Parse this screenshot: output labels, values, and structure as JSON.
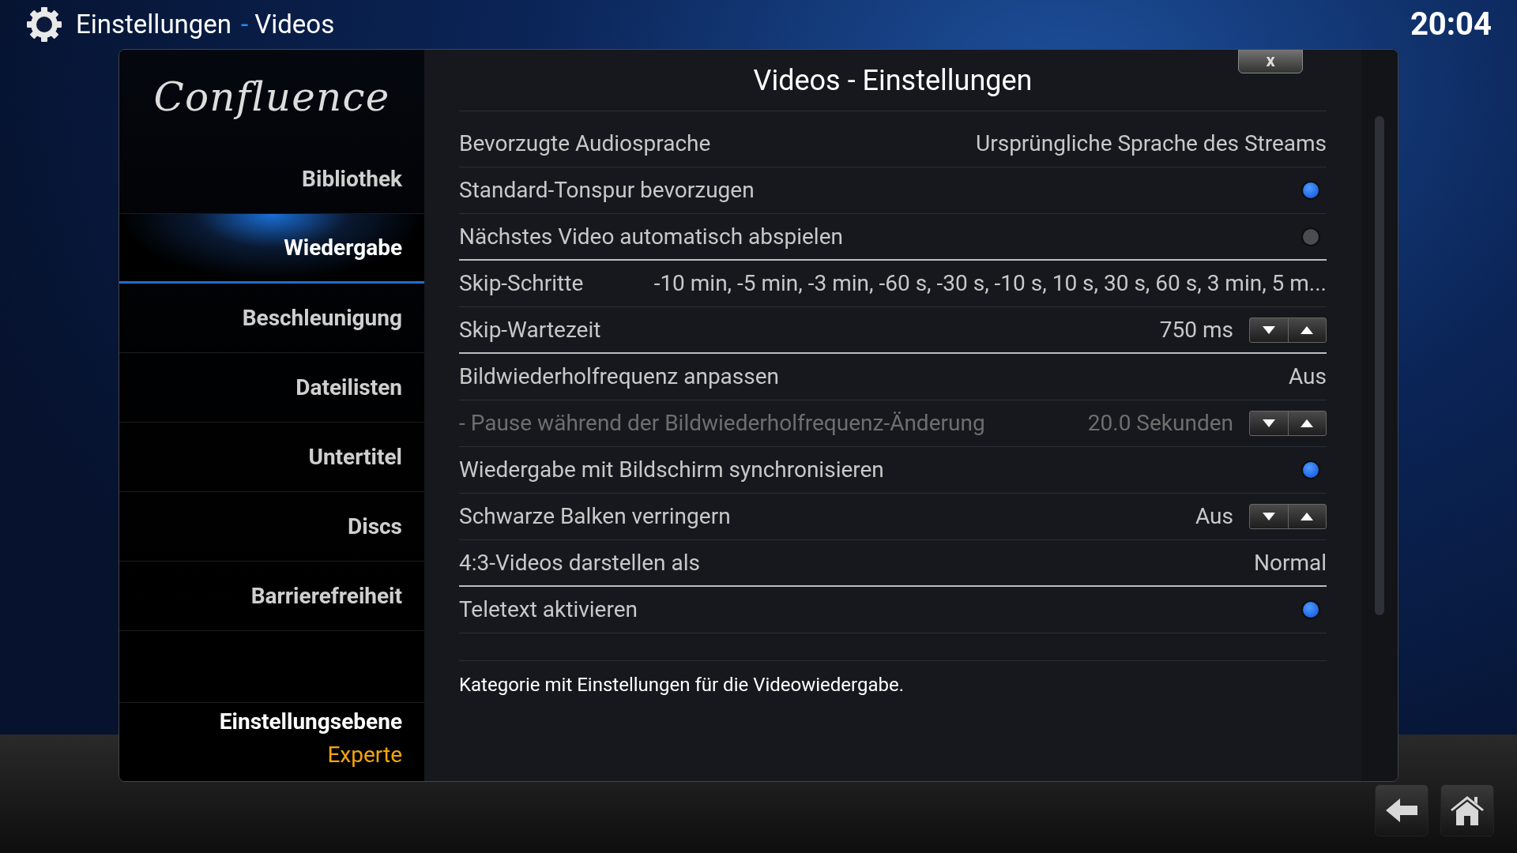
{
  "header": {
    "section": "Einstellungen",
    "separator": "-",
    "page": "Videos",
    "clock": "20:04"
  },
  "logo": {
    "text": "Confluence"
  },
  "sidebar": {
    "items": [
      {
        "label": "Bibliothek",
        "selected": false
      },
      {
        "label": "Wiedergabe",
        "selected": true
      },
      {
        "label": "Beschleunigung",
        "selected": false
      },
      {
        "label": "Dateilisten",
        "selected": false
      },
      {
        "label": "Untertitel",
        "selected": false
      },
      {
        "label": "Discs",
        "selected": false
      },
      {
        "label": "Barrierefreiheit",
        "selected": false
      }
    ],
    "level_label": "Einstellungsebene",
    "level_value": "Experte"
  },
  "dialog": {
    "title": "Videos - Einstellungen",
    "close": "x"
  },
  "settings": [
    {
      "kind": "value",
      "label": "Bevorzugte Audiosprache",
      "value": "Ursprüngliche Sprache des Streams",
      "disabled": false,
      "group_end": false
    },
    {
      "kind": "toggle",
      "label": "Standard-Tonspur bevorzugen",
      "on": true,
      "disabled": false,
      "group_end": false
    },
    {
      "kind": "toggle",
      "label": "Nächstes Video automatisch abspielen",
      "on": false,
      "disabled": false,
      "group_end": true
    },
    {
      "kind": "value",
      "label": "Skip-Schritte",
      "value": "-10 min, -5 min, -3 min, -60 s, -30 s, -10 s, 10 s, 30 s, 60 s, 3 min, 5 m...",
      "disabled": false,
      "group_end": false
    },
    {
      "kind": "spinner",
      "label": "Skip-Wartezeit",
      "value": "750 ms",
      "disabled": false,
      "group_end": true
    },
    {
      "kind": "value",
      "label": "Bildwiederholfrequenz anpassen",
      "value": "Aus",
      "disabled": false,
      "group_end": false
    },
    {
      "kind": "spinner",
      "label": "- Pause während der Bildwiederholfrequenz-Änderung",
      "value": "20.0 Sekunden",
      "disabled": true,
      "group_end": false
    },
    {
      "kind": "toggle",
      "label": "Wiedergabe mit Bildschirm synchronisieren",
      "on": true,
      "disabled": false,
      "group_end": false
    },
    {
      "kind": "spinner",
      "label": "Schwarze Balken verringern",
      "value": "Aus",
      "disabled": false,
      "group_end": false
    },
    {
      "kind": "value",
      "label": "4:3-Videos darstellen als",
      "value": "Normal",
      "disabled": false,
      "group_end": true
    },
    {
      "kind": "toggle",
      "label": "Teletext aktivieren",
      "on": true,
      "disabled": false,
      "group_end": false
    }
  ],
  "description": "Kategorie mit Einstellungen für die Videowiedergabe."
}
